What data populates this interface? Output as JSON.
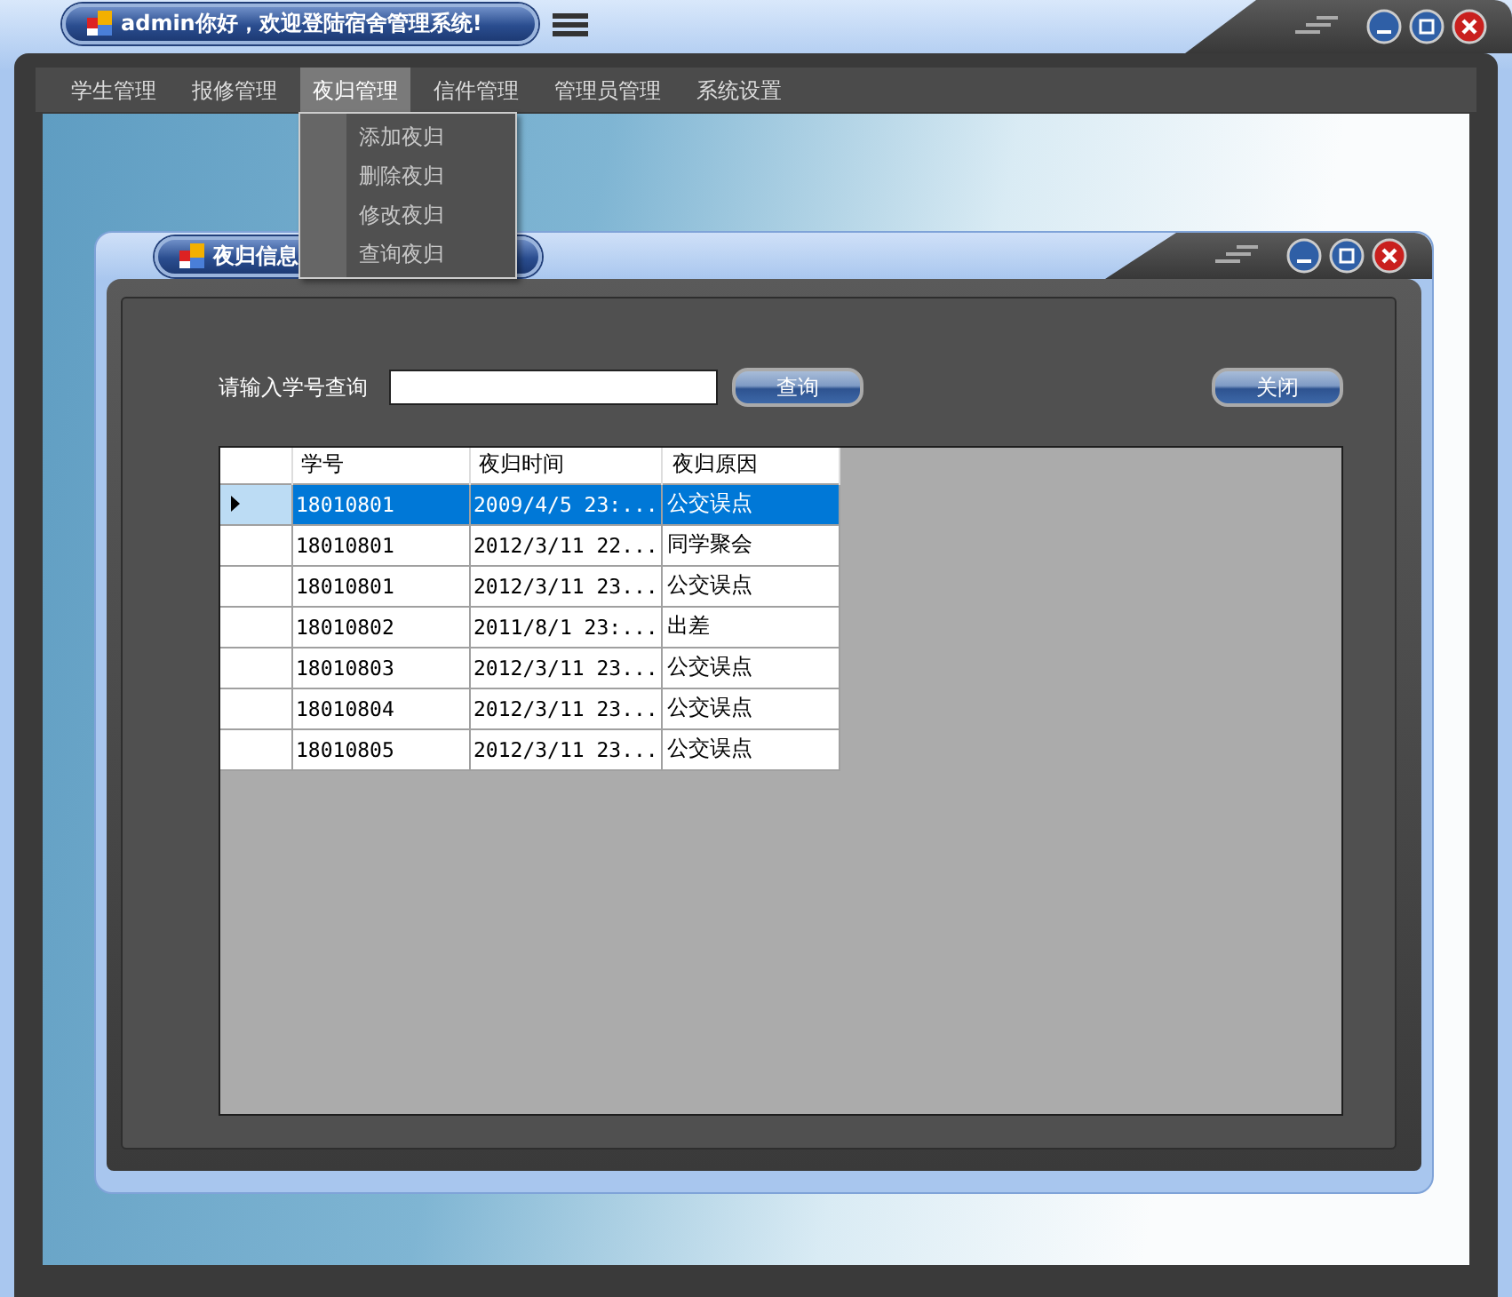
{
  "window": {
    "title": "admin你好，欢迎登陆宿舍管理系统!"
  },
  "menu_bar": {
    "items": [
      {
        "label": "学生管理",
        "selected": false
      },
      {
        "label": "报修管理",
        "selected": false
      },
      {
        "label": "夜归管理",
        "selected": true,
        "expanded": true,
        "submenu": [
          "添加夜归",
          "删除夜归",
          "修改夜归",
          "查询夜归"
        ]
      },
      {
        "label": "信件管理",
        "selected": false
      },
      {
        "label": "管理员管理",
        "selected": false
      },
      {
        "label": "系统设置",
        "selected": false
      }
    ]
  },
  "child_window": {
    "title": "夜归信息",
    "search": {
      "label": "请输入学号查询",
      "button": "查询"
    },
    "close_button": "关闭",
    "table": {
      "columns": [
        "学号",
        "夜归时间",
        "夜归原因"
      ],
      "rows": [
        {
          "cells": [
            "18010801",
            "2009/4/5 23:...",
            "公交误点"
          ],
          "selected": true
        },
        {
          "cells": [
            "18010801",
            "2012/3/11 22...",
            "同学聚会"
          ],
          "selected": false
        },
        {
          "cells": [
            "18010801",
            "2012/3/11 23...",
            "公交误点"
          ],
          "selected": false
        },
        {
          "cells": [
            "18010802",
            "2011/8/1 23:...",
            "出差"
          ],
          "selected": false
        },
        {
          "cells": [
            "18010803",
            "2012/3/11 23...",
            "公交误点"
          ],
          "selected": false
        },
        {
          "cells": [
            "18010804",
            "2012/3/11 23...",
            "公交误点"
          ],
          "selected": false
        },
        {
          "cells": [
            "18010805",
            "2012/3/11 23...",
            "公交误点"
          ],
          "selected": false
        }
      ]
    }
  }
}
